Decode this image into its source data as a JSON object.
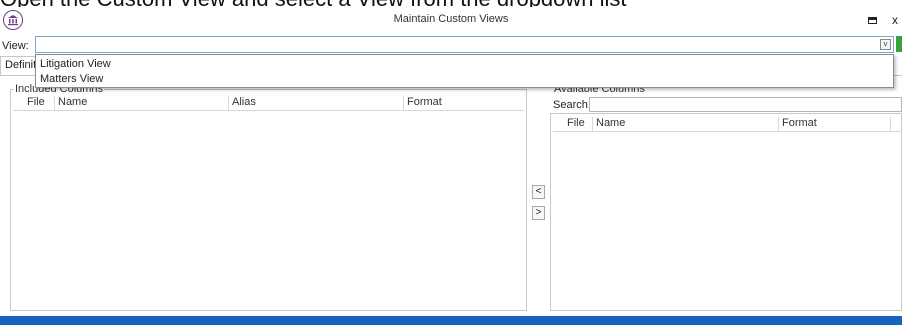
{
  "caption": "Open the Custom View and select a View from the dropdown list",
  "window": {
    "title": "Maintain Custom Views",
    "maximize_glyph": "",
    "close_glyph": "x"
  },
  "view_row": {
    "label": "View:",
    "current_value": "",
    "arrow_glyph": "˅"
  },
  "tabs": [
    {
      "label": "Definition"
    }
  ],
  "dropdown": {
    "options": [
      "Litigation View",
      "Matters View"
    ]
  },
  "included_columns": {
    "title": "Included Columns",
    "headers": [
      "File",
      "Name",
      "Alias",
      "Format"
    ]
  },
  "move_buttons": {
    "left_label": "<",
    "right_label": ">"
  },
  "available_columns": {
    "title": "Available Columns",
    "search_label": "Search:",
    "search_value": "",
    "headers": [
      "File",
      "Name",
      "Format"
    ]
  },
  "colors": {
    "accent": "#1565c0",
    "select_border": "#7aa7d9",
    "add_green": "#3aa23a",
    "logo_purple": "#6a3d8f"
  },
  "icons": {
    "app": "building-columns-icon",
    "add": "plus-icon",
    "maximize": "maximize-icon",
    "close": "close-icon"
  }
}
